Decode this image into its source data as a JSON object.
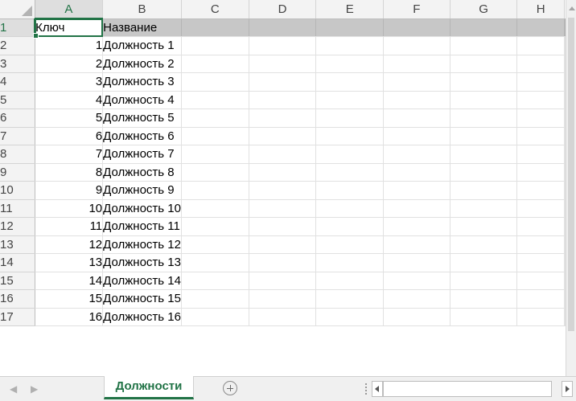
{
  "columns": [
    "A",
    "B",
    "C",
    "D",
    "E",
    "F",
    "G",
    "H"
  ],
  "selected_column": "A",
  "rows": [
    {
      "row": "1",
      "a": "Ключ",
      "b": "Название"
    },
    {
      "row": "2",
      "a": "1",
      "b": "Должность 1"
    },
    {
      "row": "3",
      "a": "2",
      "b": "Должность 2"
    },
    {
      "row": "4",
      "a": "3",
      "b": "Должность 3"
    },
    {
      "row": "5",
      "a": "4",
      "b": "Должность 4"
    },
    {
      "row": "6",
      "a": "5",
      "b": "Должность 5"
    },
    {
      "row": "7",
      "a": "6",
      "b": "Должность 6"
    },
    {
      "row": "8",
      "a": "7",
      "b": "Должность 7"
    },
    {
      "row": "9",
      "a": "8",
      "b": "Должность 8"
    },
    {
      "row": "10",
      "a": "9",
      "b": "Должность 9"
    },
    {
      "row": "11",
      "a": "10",
      "b": "Должность 10"
    },
    {
      "row": "12",
      "a": "11",
      "b": "Должность 11"
    },
    {
      "row": "13",
      "a": "12",
      "b": "Должность 12"
    },
    {
      "row": "14",
      "a": "13",
      "b": "Должность 13"
    },
    {
      "row": "15",
      "a": "14",
      "b": "Должность 14"
    },
    {
      "row": "16",
      "a": "15",
      "b": "Должность 15"
    },
    {
      "row": "17",
      "a": "16",
      "b": "Должность 16"
    }
  ],
  "sheet_tab": {
    "label": "Должности"
  },
  "colors": {
    "accent": "#217346",
    "header_fill": "#c7c7c7",
    "gridline": "#e1e1e1"
  },
  "icons": {
    "add_sheet": "plus-circle-icon",
    "prev_sheet": "chevron-left-icon",
    "next_sheet": "chevron-right-icon"
  }
}
